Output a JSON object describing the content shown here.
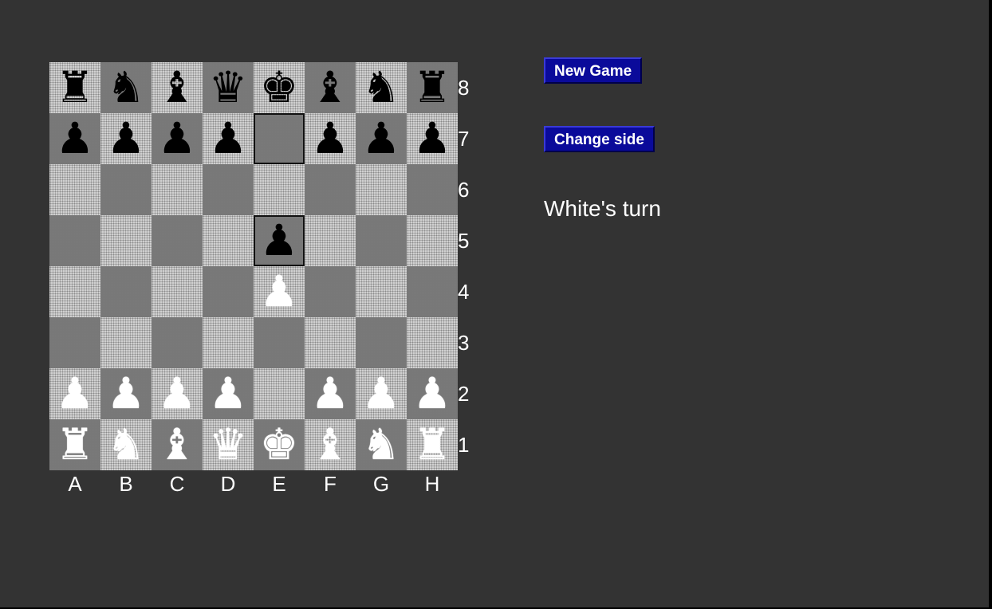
{
  "buttons": {
    "new_game": "New Game",
    "change_side": "Change side"
  },
  "status": "White's turn",
  "board": {
    "files": [
      "A",
      "B",
      "C",
      "D",
      "E",
      "F",
      "G",
      "H"
    ],
    "ranks": [
      "8",
      "7",
      "6",
      "5",
      "4",
      "3",
      "2",
      "1"
    ],
    "rows": [
      [
        "bR",
        "bN",
        "bB",
        "bQ",
        "bK",
        "bB",
        "bN",
        "bR"
      ],
      [
        "bP",
        "bP",
        "bP",
        "bP",
        "",
        "bP",
        "bP",
        "bP"
      ],
      [
        "",
        "",
        "",
        "",
        "",
        "",
        "",
        ""
      ],
      [
        "",
        "",
        "",
        "",
        "bP",
        "",
        "",
        ""
      ],
      [
        "",
        "",
        "",
        "",
        "wP",
        "",
        "",
        ""
      ],
      [
        "",
        "",
        "",
        "",
        "",
        "",
        "",
        ""
      ],
      [
        "wP",
        "wP",
        "wP",
        "wP",
        "",
        "wP",
        "wP",
        "wP"
      ],
      [
        "wR",
        "wN",
        "wB",
        "wQ",
        "wK",
        "wB",
        "wN",
        "wR"
      ]
    ],
    "last_move": [
      "e7",
      "e5"
    ]
  },
  "pieces": {
    "K": "♚",
    "Q": "♛",
    "R": "♜",
    "B": "♝",
    "N": "♞",
    "P": "♟"
  },
  "piece_names": {
    "K": "king",
    "Q": "queen",
    "R": "rook",
    "B": "bishop",
    "N": "knight",
    "P": "pawn"
  },
  "colors": {
    "background": "#333333",
    "button": "#0a0a9a",
    "text": "#ffffff"
  }
}
